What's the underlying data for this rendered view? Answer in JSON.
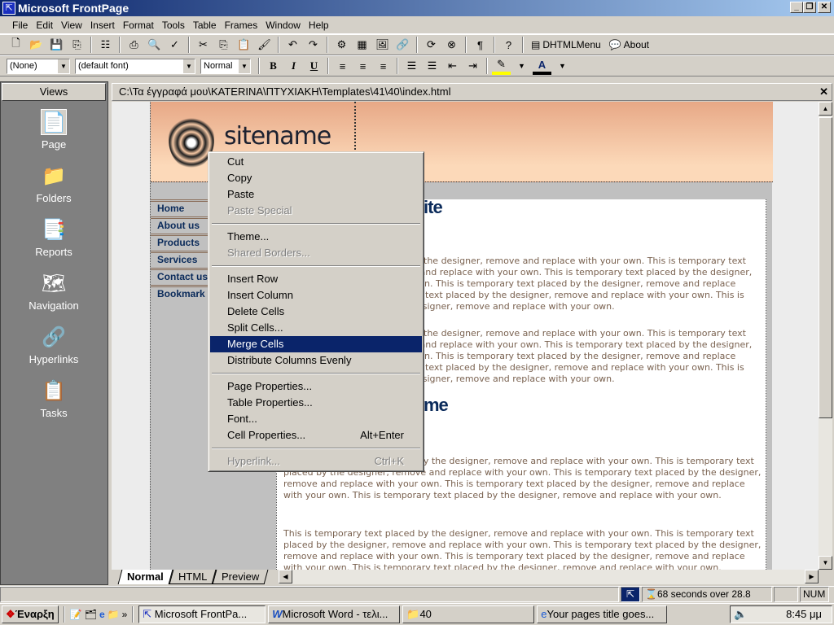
{
  "window": {
    "title": "Microsoft FrontPage",
    "controls": [
      "_",
      "❐",
      "✕"
    ]
  },
  "menu": [
    "File",
    "Edit",
    "View",
    "Insert",
    "Format",
    "Tools",
    "Table",
    "Frames",
    "Window",
    "Help"
  ],
  "toolbar": {
    "icons": [
      "new-page-icon",
      "open-icon",
      "save-icon",
      "publish-icon",
      "folder-list-icon",
      "print-icon",
      "preview-icon",
      "spelling-icon",
      "cut-icon",
      "copy-icon",
      "paste-icon",
      "format-painter-icon",
      "undo-icon",
      "redo-icon",
      "insert-component-icon",
      "insert-table-icon",
      "insert-picture-icon",
      "hyperlink-icon",
      "refresh-icon",
      "stop-icon",
      "show-all-icon",
      "help-icon"
    ],
    "dhtml_label": "DHTMLMenu",
    "about_label": "About"
  },
  "format_bar": {
    "style": "(None)",
    "font": "(default font)",
    "size": "Normal",
    "bold": "B",
    "italic": "I",
    "underline": "U"
  },
  "views": {
    "header": "Views",
    "items": [
      {
        "label": "Page",
        "icon": "page-icon"
      },
      {
        "label": "Folders",
        "icon": "folders-icon"
      },
      {
        "label": "Reports",
        "icon": "reports-icon"
      },
      {
        "label": "Navigation",
        "icon": "navigation-icon"
      },
      {
        "label": "Hyperlinks",
        "icon": "hyperlinks-icon"
      },
      {
        "label": "Tasks",
        "icon": "tasks-icon"
      }
    ]
  },
  "document": {
    "path": "C:\\Τα έγγραφά μου\\KATERINA\\ΠΤΥΧΙΑΚΗ\\Templates\\41\\40\\index.html"
  },
  "site": {
    "name": "sitename",
    "nav": [
      "Home",
      "About us",
      "Products",
      "Services",
      "Contact us",
      "Bookmark"
    ],
    "heading1_visible": "ite",
    "heading2_visible": "me",
    "para_partial": "r the designer, remove and replace with your own. This is temporary text\n and replace with your own. This is temporary text placed by the designer,\nwn. This is temporary text placed by the designer, remove and replace\ny text placed by the designer, remove and replace with your own. This is\nesigner, remove and replace with your own.",
    "para_full": "This is temporary text placed by the designer, remove and replace with your own. This is temporary text placed by the designer, remove and replace with your own. This is temporary text placed by the designer, remove and replace with your own. This is temporary text placed by the designer, remove and replace with your own. This is temporary text placed by the designer, remove and replace with your own."
  },
  "context_menu": {
    "items": [
      {
        "label": "Cut",
        "disabled": false
      },
      {
        "label": "Copy",
        "disabled": false
      },
      {
        "label": "Paste",
        "disabled": false
      },
      {
        "label": "Paste Special",
        "disabled": true
      },
      {
        "sep": true
      },
      {
        "label": "Theme...",
        "disabled": false
      },
      {
        "label": "Shared Borders...",
        "disabled": true
      },
      {
        "sep": true
      },
      {
        "label": "Insert Row"
      },
      {
        "label": "Insert Column"
      },
      {
        "label": "Delete Cells"
      },
      {
        "label": "Split Cells..."
      },
      {
        "label": "Merge Cells",
        "selected": true
      },
      {
        "label": "Distribute Columns Evenly"
      },
      {
        "sep": true
      },
      {
        "label": "Page Properties..."
      },
      {
        "label": "Table Properties..."
      },
      {
        "label": "Font..."
      },
      {
        "label": "Cell Properties...",
        "shortcut": "Alt+Enter"
      },
      {
        "sep": true
      },
      {
        "label": "Hyperlink...",
        "shortcut": "Ctrl+K",
        "disabled": true
      }
    ]
  },
  "tabs": [
    "Normal",
    "HTML",
    "Preview"
  ],
  "status": {
    "download_time": "68 seconds over 28.8",
    "num": "NUM"
  },
  "taskbar": {
    "start": "Έναρξη",
    "buttons": [
      "Microsoft FrontPa...",
      "Microsoft Word - τελι...",
      "40",
      "Your pages title goes..."
    ],
    "clock": "8:45 μμ"
  },
  "colors": {
    "title_start": "#0a246a",
    "title_end": "#a6caf0",
    "menu_highlight": "#0a246a",
    "nav_text": "#0a2a5a",
    "body_text": "#7a6250"
  }
}
